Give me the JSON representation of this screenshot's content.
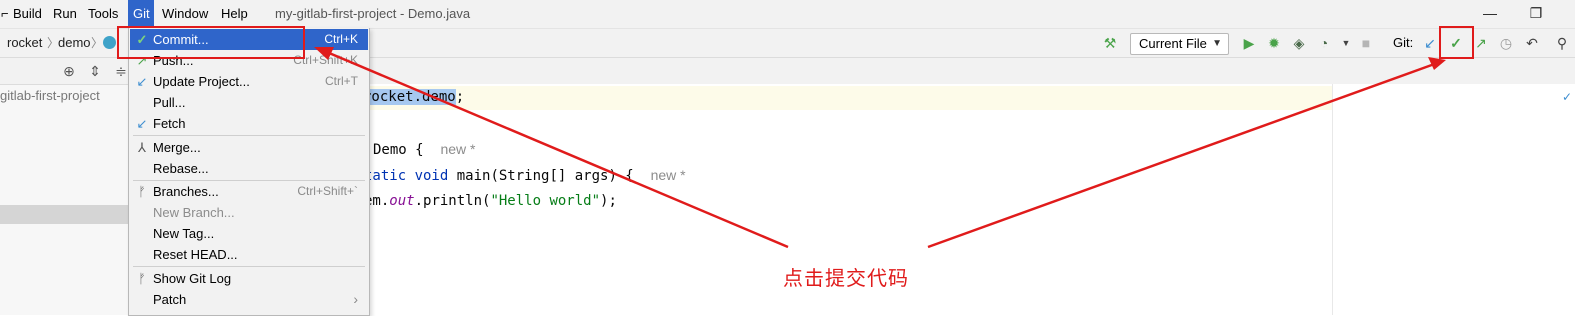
{
  "menubar": {
    "items": [
      {
        "label": "Build"
      },
      {
        "label": "Run"
      },
      {
        "label": "Tools"
      },
      {
        "label": "Git"
      },
      {
        "label": "Window"
      },
      {
        "label": "Help"
      }
    ],
    "window_title": "my-gitlab-first-project - Demo.java",
    "minimize_glyph": "—",
    "restore_glyph": "❐"
  },
  "breadcrumb": {
    "items": [
      "rocket",
      "demo"
    ]
  },
  "toolbar": {
    "run_config_label": "Current File",
    "git_label": "Git:"
  },
  "project": {
    "root_label": "gitlab-first-project"
  },
  "git_menu": {
    "items": [
      {
        "label": "Commit...",
        "shortcut": "Ctrl+K",
        "icon": "check-icon"
      },
      {
        "label": "Push...",
        "shortcut": "Ctrl+Shift+K",
        "icon": "push-arrow-icon"
      },
      {
        "label": "Update Project...",
        "shortcut": "Ctrl+T",
        "icon": "update-arrow-icon"
      },
      {
        "label": "Pull...",
        "shortcut": "",
        "icon": ""
      },
      {
        "label": "Fetch",
        "shortcut": "",
        "icon": "fetch-arrow-icon"
      },
      {
        "label": "Merge...",
        "shortcut": "",
        "icon": "merge-icon"
      },
      {
        "label": "Rebase...",
        "shortcut": "",
        "icon": ""
      },
      {
        "label": "Branches...",
        "shortcut": "Ctrl+Shift+`",
        "icon": "branch-icon"
      },
      {
        "label": "New Branch...",
        "shortcut": "",
        "icon": ""
      },
      {
        "label": "New Tag...",
        "shortcut": "",
        "icon": ""
      },
      {
        "label": "Reset HEAD...",
        "shortcut": "",
        "icon": ""
      },
      {
        "label": "Show Git Log",
        "shortcut": "",
        "icon": "git-log-icon"
      },
      {
        "label": "Patch",
        "shortcut": "›",
        "icon": ""
      }
    ]
  },
  "editor": {
    "lines": {
      "pkg": "rocket.demo",
      "pkg_end": ";",
      "class_decl": "Demo {",
      "class_hint": "new *",
      "main_kw": "tatic void",
      "main_rest": " main(String[] args) {",
      "main_hint": "new *",
      "print_pre": "em.",
      "print_field": "out",
      "print_mid": ".println(",
      "print_str": "\"Hello world\"",
      "print_end": ");"
    }
  },
  "annotation": {
    "text": "点击提交代码",
    "color": "#e01b1b"
  },
  "colors": {
    "menu_selection": "#2f65ca",
    "annotation_red": "#e01b1b",
    "run_green": "#4aa34a",
    "git_blue": "#3e8ed0"
  }
}
